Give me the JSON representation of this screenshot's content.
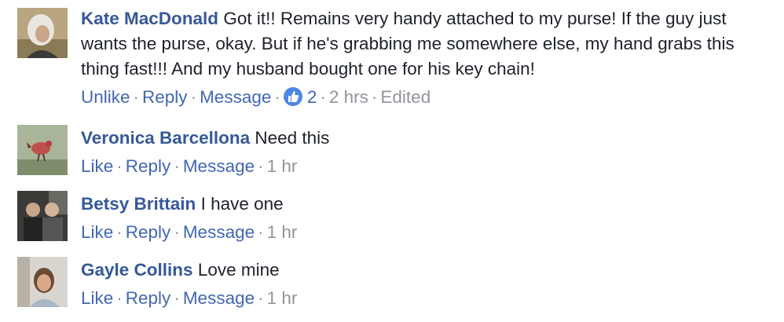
{
  "comments": [
    {
      "author": "Kate MacDonald",
      "text": "Got it!! Remains very handy attached to my purse! If the guy just wants the purse, okay. But if he's grabbing me somewhere else, my hand grabs this thing fast!!! And my husband bought one for his key chain!",
      "actions": {
        "like": "Unlike",
        "reply": "Reply",
        "message": "Message"
      },
      "like_count": "2",
      "time": "2 hrs",
      "edited": "Edited",
      "icon": "like-thumb-icon"
    },
    {
      "author": "Veronica Barcellona",
      "text": "Need this",
      "actions": {
        "like": "Like",
        "reply": "Reply",
        "message": "Message"
      },
      "time": "1 hr"
    },
    {
      "author": "Betsy Brittain",
      "text": "I have one",
      "actions": {
        "like": "Like",
        "reply": "Reply",
        "message": "Message"
      },
      "time": "1 hr"
    },
    {
      "author": "Gayle Collins",
      "text": "Love mine",
      "actions": {
        "like": "Like",
        "reply": "Reply",
        "message": "Message"
      },
      "time": "1 hr"
    }
  ],
  "colors": {
    "author": "#365899",
    "link": "#4267b2",
    "meta": "#90949c",
    "text": "#1d2129",
    "like_badge": "#4e86e4"
  }
}
